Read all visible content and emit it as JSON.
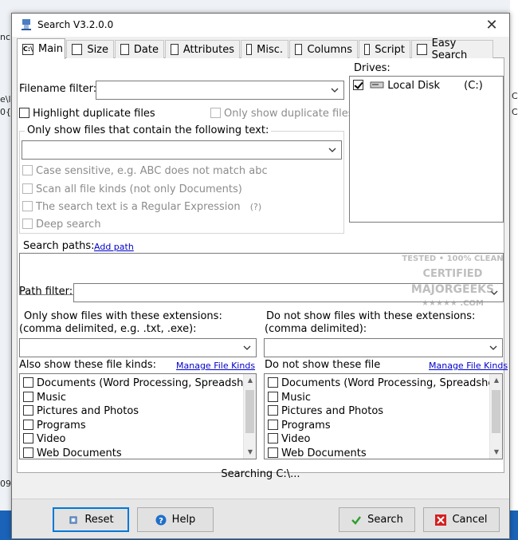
{
  "window": {
    "title": "Search V3.2.0.0",
    "close_glyph": "✕"
  },
  "background": {
    "frag_left_1": "nc",
    "frag_left_2": "e\\l",
    "frag_left_3": "0{",
    "frag_left_4": "09",
    "frag_right_1": "C",
    "frag_right_2": "C"
  },
  "tabs": [
    {
      "label": "Main",
      "icon": "C:\\"
    },
    {
      "label": "Size"
    },
    {
      "label": "Date"
    },
    {
      "label": "Attributes"
    },
    {
      "label": "Misc."
    },
    {
      "label": "Columns"
    },
    {
      "label": "Script"
    },
    {
      "label": "Easy Search"
    }
  ],
  "main": {
    "filename_filter_label": "Filename filter:",
    "filename_filter_value": "",
    "highlight_duplicates": "Highlight duplicate files",
    "only_show_duplicates": "Only show duplicate files",
    "text_group_legend": "Only show files that contain the following text:",
    "text_value": "",
    "case_sensitive": "Case sensitive, e.g. ABC does not match abc",
    "scan_all": "Scan all file kinds (not only Documents)",
    "regex": "The search text is a Regular Expression",
    "regex_help": "(?)",
    "deep_search": "Deep search",
    "drives_label": "Drives:",
    "drive_name": "Local Disk",
    "drive_letter": "(C:)",
    "search_paths_label": "Search paths:",
    "add_path_link": "Add path",
    "path_filter_label": "Path filter:",
    "include_ext_label_1": "Only show files with these extensions:",
    "include_ext_label_2": "(comma delimited, e.g. .txt, .exe):",
    "exclude_ext_label_1": "Do not show files with these extensions:",
    "exclude_ext_label_2": "(comma delimited):",
    "also_show_kinds_label": "Also show these file kinds:",
    "do_not_show_label": "Do not show these file",
    "manage_kinds_link": "Manage File Kinds",
    "file_kinds": [
      "Documents (Word Processing, Spreadsheets",
      "Music",
      "Pictures and Photos",
      "Programs",
      "Video",
      "Web Documents"
    ]
  },
  "status_text": "Searching C:\\...",
  "buttons": {
    "reset": "Reset",
    "help": "Help",
    "search": "Search",
    "cancel": "Cancel"
  },
  "watermark": {
    "line1": "TESTED • 100% CLEAN",
    "line2": "CERTIFIED",
    "line3": "MAJORGEEKS",
    "line4": "★★★★★ .COM"
  },
  "colors": {
    "accent": "#0078d7",
    "link": "#0000cc",
    "search_icon": "#2e9e2e",
    "cancel_icon": "#d42020",
    "help_icon": "#1f6fc8"
  }
}
